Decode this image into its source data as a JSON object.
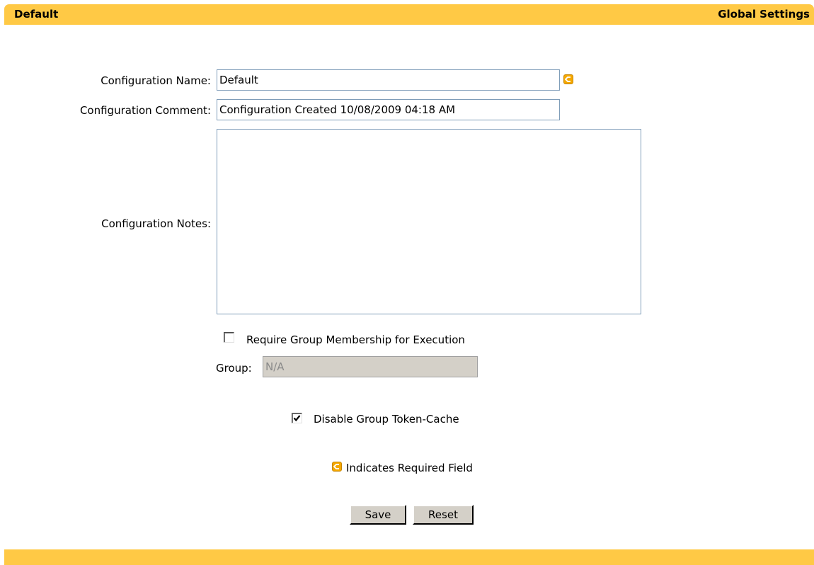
{
  "header": {
    "title": "Default",
    "right_title": "Global Settings"
  },
  "form": {
    "config_name_label": "Configuration Name:",
    "config_name_value": "Default",
    "config_comment_label": "Configuration Comment:",
    "config_comment_value": "Configuration Created 10/08/2009 04:18 AM",
    "config_notes_label": "Configuration Notes:",
    "config_notes_value": "",
    "require_group_label": "Require Group Membership for Execution",
    "require_group_checked": false,
    "group_label": "Group:",
    "group_value": "N/A",
    "disable_cache_label": "Disable Group Token-Cache",
    "disable_cache_checked": true,
    "required_note": "Indicates Required Field",
    "save_label": "Save",
    "reset_label": "Reset"
  },
  "icons": {
    "required": "required-field-arrow-icon",
    "checkmark": "checkmark-icon"
  },
  "colors": {
    "header_bar": "#ffc945",
    "required_icon": "#f5a800",
    "disabled_field": "#d4d0c8",
    "button_face": "#d4d0c8"
  }
}
